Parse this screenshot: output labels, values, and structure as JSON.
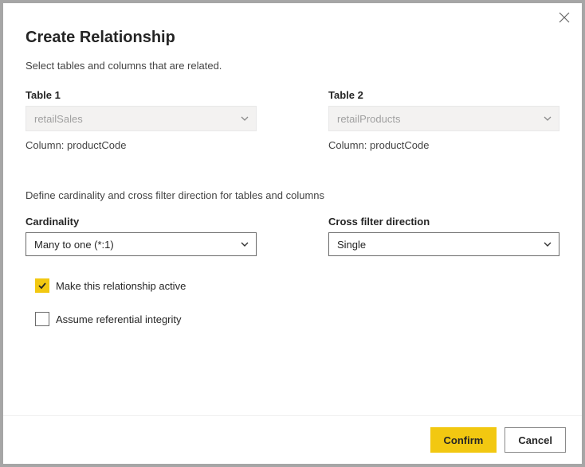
{
  "dialog": {
    "title": "Create Relationship",
    "subtitle": "Select tables and columns that are related."
  },
  "table1": {
    "label": "Table 1",
    "value": "retailSales",
    "column_label": "Column:",
    "column_value": "productCode"
  },
  "table2": {
    "label": "Table 2",
    "value": "retailProducts",
    "column_label": "Column:",
    "column_value": "productCode"
  },
  "section2_note": "Define cardinality and cross filter direction for tables and columns",
  "cardinality": {
    "label": "Cardinality",
    "value": "Many to one (*:1)"
  },
  "crossfilter": {
    "label": "Cross filter direction",
    "value": "Single"
  },
  "checkboxes": {
    "active_label": "Make this relationship active",
    "active_checked": true,
    "referential_label": "Assume referential integrity",
    "referential_checked": false
  },
  "footer": {
    "confirm": "Confirm",
    "cancel": "Cancel"
  }
}
